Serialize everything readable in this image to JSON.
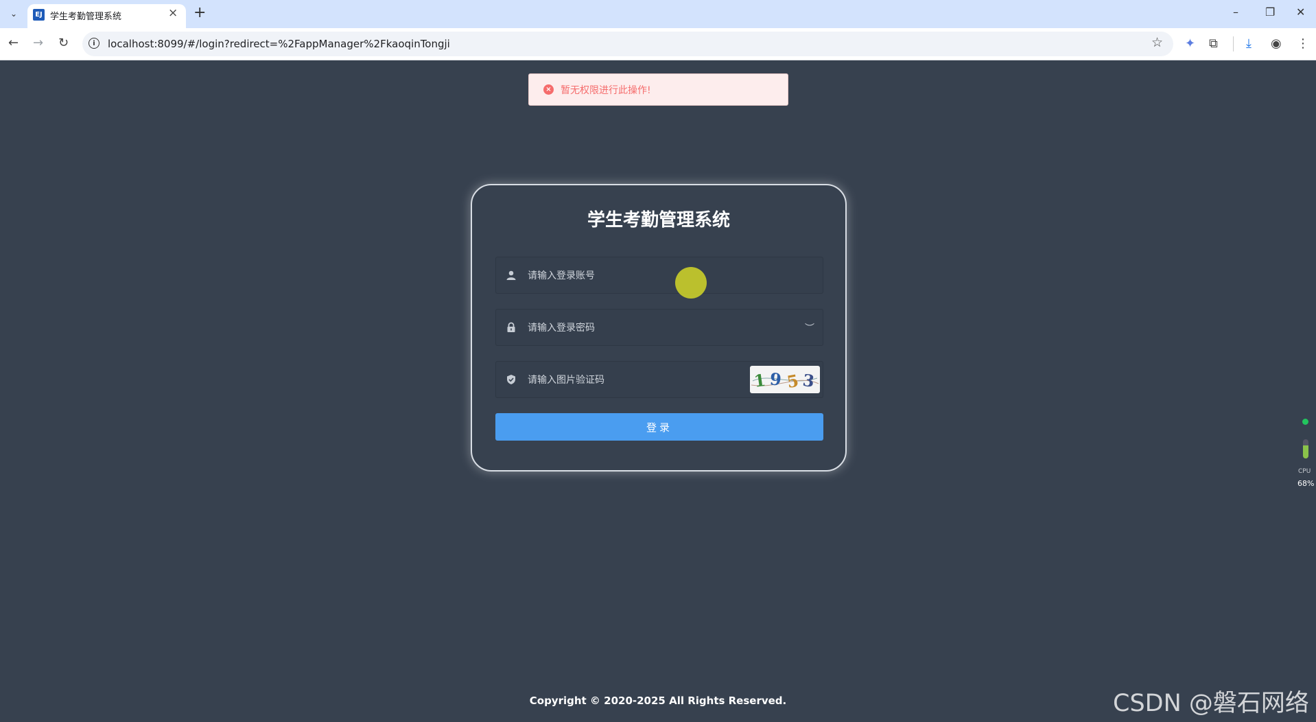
{
  "browser": {
    "tab_title": "学生考勤管理系统",
    "favicon_text": "EJ",
    "new_tab_label": "+",
    "url": "localhost:8099/#/login?redirect=%2FappManager%2FkaoqinTongji"
  },
  "alert": {
    "message": "暂无权限进行此操作!",
    "type": "error",
    "color": "#f56c6c"
  },
  "login": {
    "title": "学生考勤管理系统",
    "username_placeholder": "请输入登录账号",
    "password_placeholder": "请输入登录密码",
    "captcha_placeholder": "请输入图片验证码",
    "captcha_code": "1953",
    "submit_label": "登录",
    "accent_color": "#4a9df0"
  },
  "footer": {
    "copyright": "Copyright © 2020-2025 All Rights Reserved."
  },
  "watermark": "CSDN @磐石网络",
  "system_widget": {
    "label": "CPU",
    "value": "68%"
  },
  "background_color": "#37414f"
}
